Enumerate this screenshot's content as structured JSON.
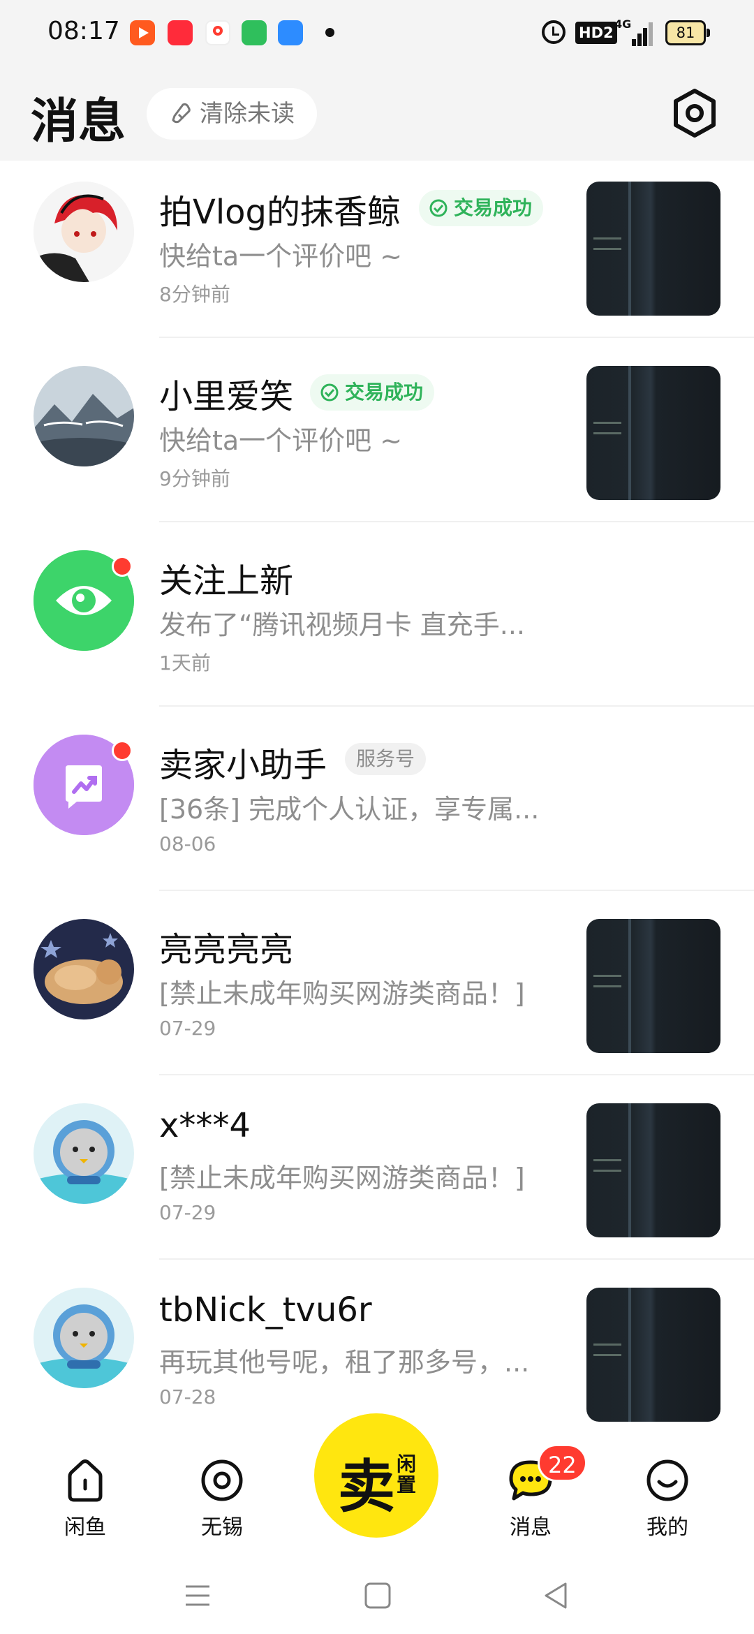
{
  "status_bar": {
    "time": "08:17",
    "battery": "81",
    "network": "4G",
    "hd_label": "HD2"
  },
  "header": {
    "title": "消息",
    "clear_unread": "清除未读"
  },
  "messages": [
    {
      "name": "拍Vlog的抹香鲸",
      "badge": "交易成功",
      "preview": "快给ta一个评价吧 ~",
      "time": "8分钟前"
    },
    {
      "name": "小里爱笑",
      "badge": "交易成功",
      "preview": "快给ta一个评价吧 ~",
      "time": "9分钟前"
    },
    {
      "name": "关注上新",
      "preview": "发布了“腾讯视频月卡 直充手...",
      "time": "1天前"
    },
    {
      "name": "卖家小助手",
      "badge": "服务号",
      "preview": "[36条] 完成个人认证，享专属...",
      "time": "08-06"
    },
    {
      "name": "亮亮亮亮",
      "preview": "[禁止未成年购买网游类商品！]",
      "time": "07-29"
    },
    {
      "name": "x***4",
      "preview": "[禁止未成年购买网游类商品！]",
      "time": "07-29"
    },
    {
      "name": "tbNick_tvu6r",
      "preview": "再玩其他号呢，租了那多号，...",
      "time": "07-28"
    }
  ],
  "bottom_nav": {
    "home": "闲鱼",
    "city": "无锡",
    "sell_main": "卖",
    "sell_sub": "闲置",
    "messages": "消息",
    "messages_badge": "22",
    "mine": "我的"
  },
  "colors": {
    "accent_yellow": "#ffe60f",
    "success_green": "#2fb35a",
    "badge_red": "#ff3b30"
  }
}
